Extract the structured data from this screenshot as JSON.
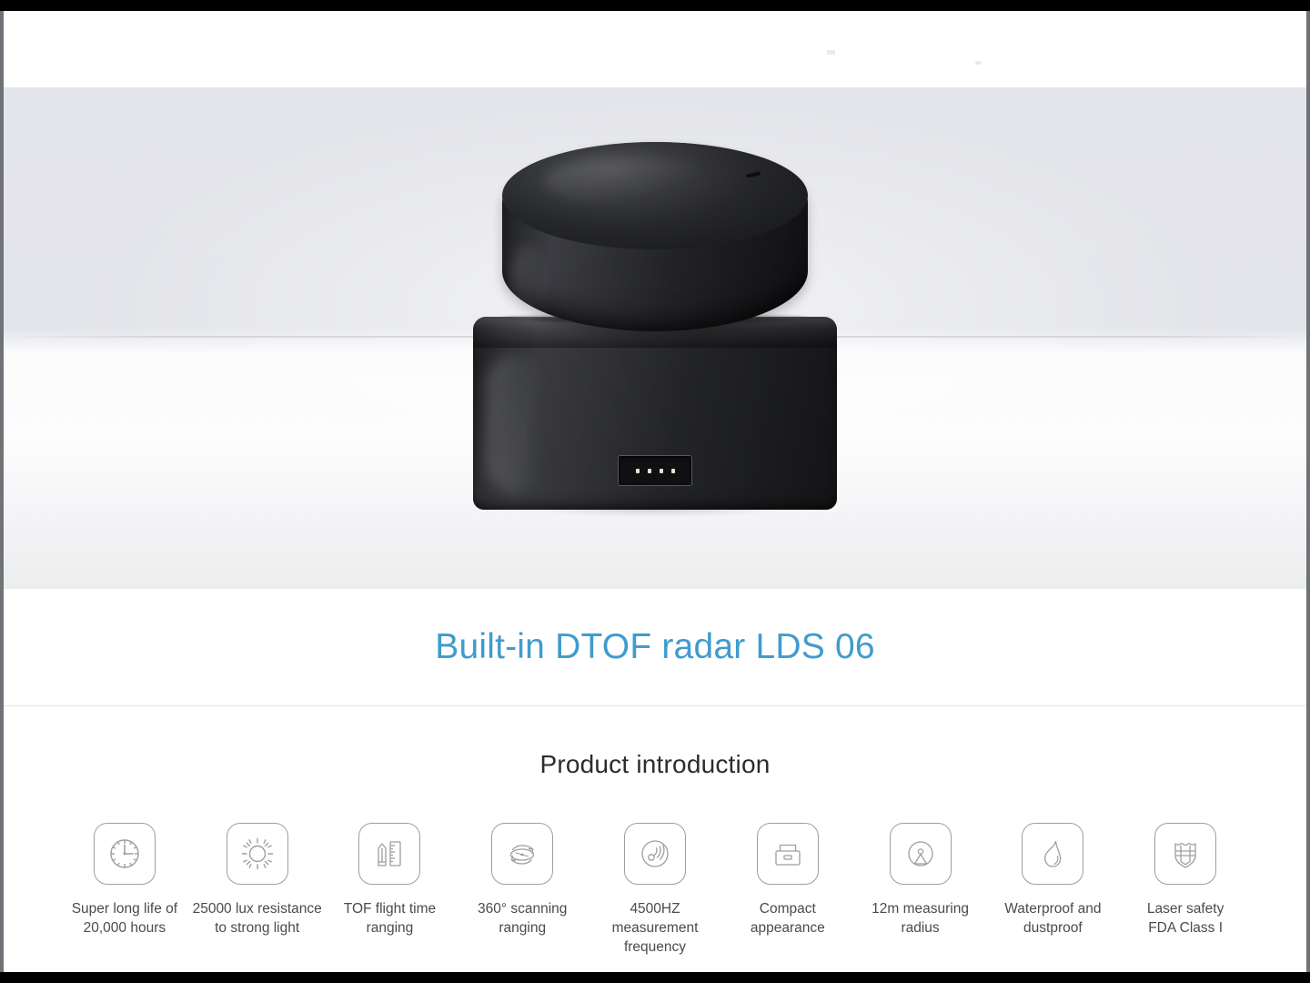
{
  "page": {
    "background_color": "#ffffff",
    "letterbox_color": "#000000",
    "accent_color": "#3f9ccd",
    "icon_stroke_color": "#9c9ea3",
    "text_color": "#4b4b4d"
  },
  "hero": {
    "alt": "Black cylindrical DTOF LiDAR sensor with square base and four-pin connector",
    "background_top_color": "#e4e5ea",
    "background_bottom_color": "#fdfdfe"
  },
  "title": {
    "text": "Built-in DTOF radar LDS 06"
  },
  "intro": {
    "heading": "Product introduction",
    "features": [
      {
        "icon": "clock-icon",
        "label": "Super long life of\n20,000 hours"
      },
      {
        "icon": "sun-icon",
        "label": "25000 lux resistance\nto strong light"
      },
      {
        "icon": "ruler-pencil-icon",
        "label": "TOF flight time\nranging"
      },
      {
        "icon": "rotation-360-icon",
        "label": "360° scanning\nranging"
      },
      {
        "icon": "signal-wave-icon",
        "label": "4500HZ measurement\nfrequency"
      },
      {
        "icon": "compact-box-icon",
        "label": "Compact\nappearance"
      },
      {
        "icon": "radar-sweep-icon",
        "label": "12m measuring\nradius"
      },
      {
        "icon": "water-drop-icon",
        "label": "Waterproof and\ndustproof"
      },
      {
        "icon": "shield-icon",
        "label": "Laser safety\nFDA Class I"
      }
    ]
  }
}
